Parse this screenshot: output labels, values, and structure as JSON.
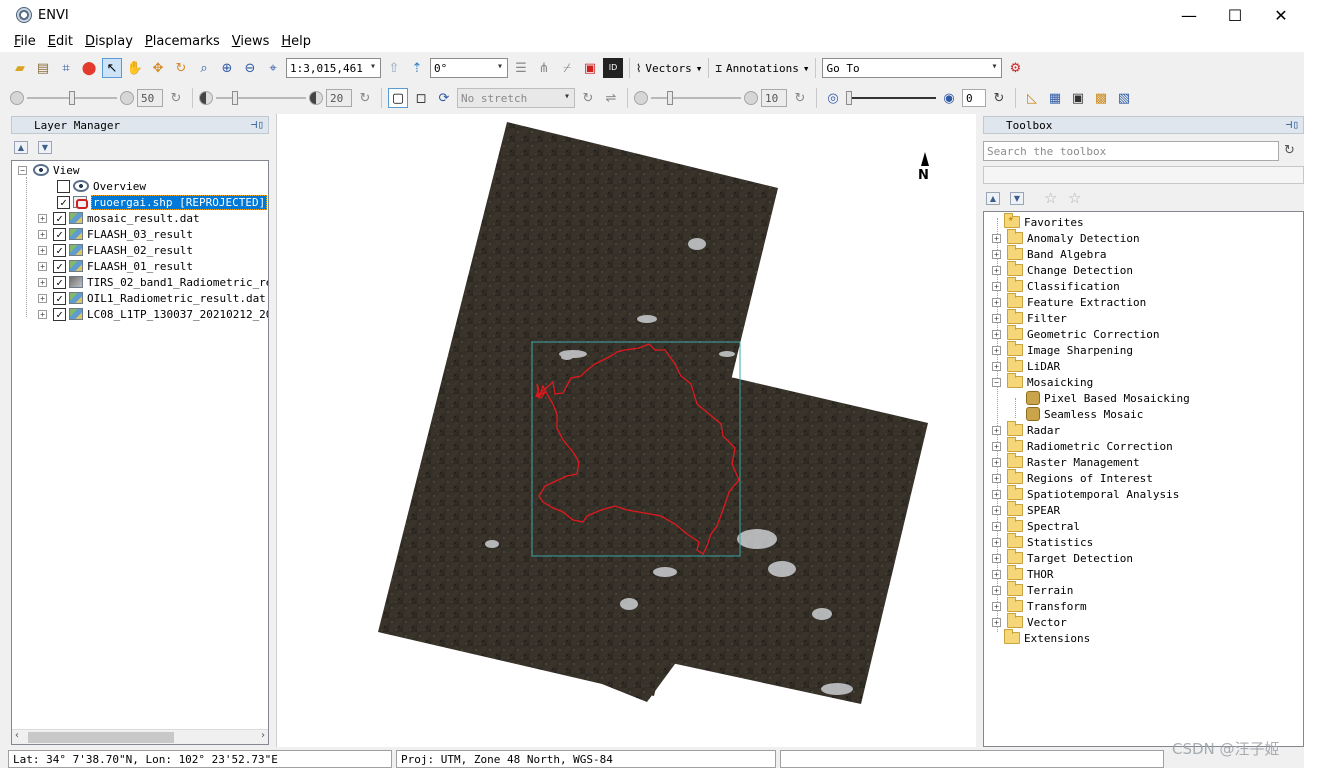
{
  "window": {
    "title": "ENVI",
    "minimize": "—",
    "maximize": "☐",
    "close": "✕"
  },
  "menu": [
    {
      "key": "F",
      "rest": "ile"
    },
    {
      "key": "E",
      "rest": "dit"
    },
    {
      "key": "D",
      "rest": "isplay"
    },
    {
      "key": "P",
      "rest": "lacemarks"
    },
    {
      "key": "V",
      "rest": "iews"
    },
    {
      "key": "H",
      "rest": "elp"
    }
  ],
  "toolbar1": {
    "scale": "1:3,015,461",
    "rotation": "0°",
    "vectors_label": "Vectors",
    "annotations_label": "Annotations",
    "goto_label": "Go To"
  },
  "toolbar2": {
    "brightness": "50",
    "contrast": "20",
    "stretch": "No stretch",
    "sharpen": "10",
    "transparency": "0"
  },
  "layer_manager": {
    "title": "Layer Manager",
    "root": "View",
    "items": [
      {
        "label": "Overview",
        "checked": false,
        "icon": "eye-icon"
      },
      {
        "label": "ruoergai.shp [REPROJECTED]",
        "checked": true,
        "icon": "vector-icon"
      },
      {
        "label": "mosaic_result.dat",
        "checked": true,
        "icon": "raster-icon"
      },
      {
        "label": "FLAASH_03_result",
        "checked": true,
        "icon": "raster-icon"
      },
      {
        "label": "FLAASH_02_result",
        "checked": true,
        "icon": "raster-icon"
      },
      {
        "label": "FLAASH_01_result",
        "checked": true,
        "icon": "raster-icon"
      },
      {
        "label": "TIRS_02_band1_Radiometric_resu",
        "checked": true,
        "icon": "gray-raster-icon"
      },
      {
        "label": "OIL1_Radiometric_result.dat",
        "checked": true,
        "icon": "raster-icon"
      },
      {
        "label": "LC08_L1TP_130037_20210212_202",
        "checked": true,
        "icon": "raster-icon"
      }
    ]
  },
  "toolbox": {
    "title": "Toolbox",
    "search_placeholder": "Search the toolbox",
    "items": [
      "Favorites",
      "Anomaly Detection",
      "Band Algebra",
      "Change Detection",
      "Classification",
      "Feature Extraction",
      "Filter",
      "Geometric Correction",
      "Image Sharpening",
      "LiDAR",
      "Mosaicking"
    ],
    "mosaicking_children": [
      "Pixel Based Mosaicking",
      "Seamless Mosaic"
    ],
    "items_after": [
      "Radar",
      "Radiometric Correction",
      "Raster Management",
      "Regions of Interest",
      "Spatiotemporal Analysis",
      "SPEAR",
      "Spectral",
      "Statistics",
      "Target Detection",
      "THOR",
      "Terrain",
      "Transform",
      "Vector",
      "Extensions"
    ]
  },
  "map": {
    "north_label": "N"
  },
  "status": {
    "latlon": "Lat: 34° 7'38.70\"N, Lon: 102° 23'52.73\"E",
    "proj": "Proj: UTM, Zone 48 North, WGS-84"
  },
  "watermark": "CSDN @汪子姬",
  "colors": {
    "selection": "#0078d7",
    "boundary": "#e0191e",
    "extent": "#3aa7a7"
  }
}
